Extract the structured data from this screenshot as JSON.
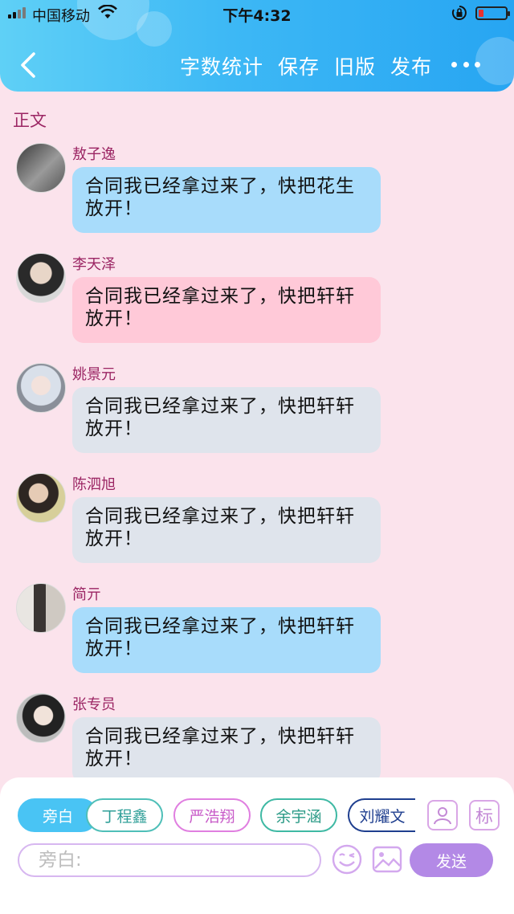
{
  "status_bar": {
    "carrier": "中国移动",
    "time": "下午4:32"
  },
  "nav": {
    "items": [
      "字数统计",
      "保存",
      "旧版",
      "发布"
    ]
  },
  "section_title": "正文",
  "messages": [
    {
      "speaker": "敖子逸",
      "text": "合同我已经拿过来了，快把花生放开！",
      "bubble_color": "#a8dcfb"
    },
    {
      "speaker": "李天泽",
      "text": "合同我已经拿过来了，快把轩轩放开！",
      "bubble_color": "#ffc9d8"
    },
    {
      "speaker": "姚景元",
      "text": "合同我已经拿过来了，快把轩轩放开！",
      "bubble_color": "#dfe4ec"
    },
    {
      "speaker": "陈泗旭",
      "text": "合同我已经拿过来了，快把轩轩放开！",
      "bubble_color": "#dfe4ec"
    },
    {
      "speaker": "简亓",
      "text": "合同我已经拿过来了，快把轩轩放开！",
      "bubble_color": "#a8dcfb"
    },
    {
      "speaker": "张专员",
      "text": "合同我已经拿过来了，快把轩轩放开！",
      "bubble_color": "#dfe4ec"
    }
  ],
  "roles": [
    {
      "label": "旁白",
      "color": "#49c4f4",
      "active": true
    },
    {
      "label": "丁程鑫",
      "color": "#4fbfb8",
      "active": false
    },
    {
      "label": "严浩翔",
      "color": "#e07fe0",
      "active": false
    },
    {
      "label": "余宇涵",
      "color": "#3fb9a4",
      "active": false
    },
    {
      "label": "刘耀文",
      "color": "#1f3f8f",
      "active": false
    }
  ],
  "tag_button_label": "标",
  "composer": {
    "placeholder": "旁白:",
    "send_label": "发送"
  },
  "icons": [
    "back-icon",
    "more-icon",
    "wifi-icon",
    "lock-rotation-icon",
    "battery-icon",
    "add-role-icon",
    "emoji-icon",
    "image-icon"
  ]
}
